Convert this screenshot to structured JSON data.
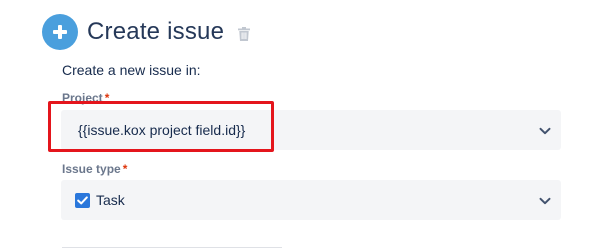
{
  "header": {
    "title": "Create issue",
    "add_icon": "plus-circle-icon",
    "delete_icon": "trash-icon"
  },
  "subtitle": "Create a new issue in:",
  "fields": {
    "project": {
      "label": "Project",
      "required_mark": "*",
      "value": "{{issue.kox project field.id}}",
      "icon": "chevron-down-icon"
    },
    "issue_type": {
      "label": "Issue type",
      "required_mark": "*",
      "value": "Task",
      "type_icon": "task-checkbox-icon",
      "icon": "chevron-down-icon"
    }
  },
  "colors": {
    "accent": "#4a9fdd",
    "highlight": "#e4151c",
    "task_icon": "#2a77db",
    "required": "#de350b",
    "field_background": "#f4f5f7"
  }
}
